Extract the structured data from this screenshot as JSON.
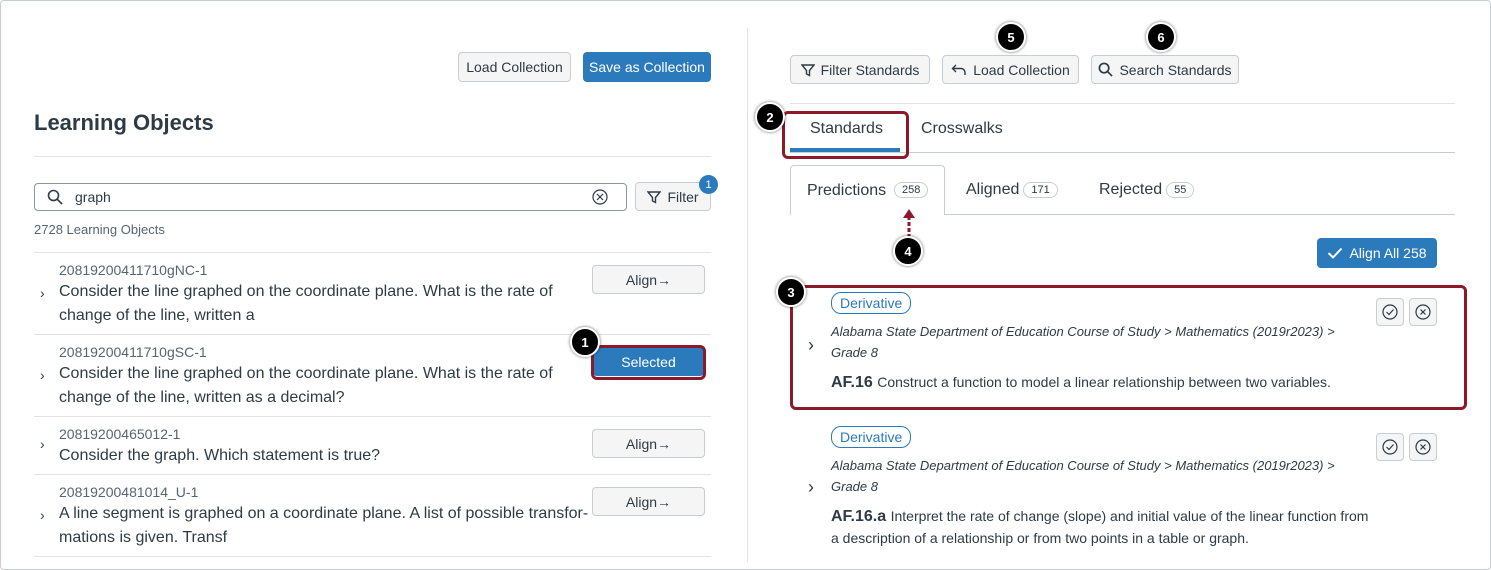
{
  "left": {
    "load_collection": "Load Collection",
    "save_collection": "Save as Collection",
    "title": "Learning Objects",
    "search_value": "graph",
    "filter_label": "Filter",
    "filter_count": "1",
    "result_count": "2728 Learning Objects",
    "rows": [
      {
        "id": "20819200411710gNC-1",
        "text1": "Consider the line graphed on the coordinate plane. What is the rate of",
        "text2": "change of the line, written a",
        "button": "Align→"
      },
      {
        "id": "20819200411710gSC-1",
        "text1": "Consider the line graphed on the coordinate plane. What is the rate of",
        "text2": "change of the line, written as a decimal?",
        "button": "Selected"
      },
      {
        "id": "20819200465012-1",
        "text1": "Consider the graph. Which statement is true?",
        "text2": "",
        "button": "Align→"
      },
      {
        "id": "20819200481014_U-1",
        "text1": "A line segment is graphed on a coordinate plane. A list of possible transfor-",
        "text2": "mations is given. Transf",
        "button": "Align→"
      }
    ]
  },
  "right": {
    "filter_standards": "Filter Standards",
    "load_collection": "Load Collection",
    "search_standards": "Search Standards",
    "tabs": [
      "Standards",
      "Crosswalks"
    ],
    "subtabs": [
      {
        "label": "Predictions",
        "count": "258"
      },
      {
        "label": "Aligned",
        "count": "171"
      },
      {
        "label": "Rejected",
        "count": "55"
      }
    ],
    "align_all": "Align All 258",
    "standards": [
      {
        "tag": "Derivative",
        "crumb1": "Alabama State Department of Education Course of Study > Mathematics (2019r2023) >",
        "crumb2": "Grade 8",
        "code": "AF.16",
        "text1": "Construct a function to model a linear relationship between two variables.",
        "text2": ""
      },
      {
        "tag": "Derivative",
        "crumb1": "Alabama State Department of Education Course of Study > Mathematics (2019r2023) >",
        "crumb2": "Grade 8",
        "code": "AF.16.a",
        "text1": "Interpret the rate of change (slope) and initial value of the linear function from",
        "text2": "a description of a relationship or from two points in a table or graph."
      }
    ]
  },
  "callouts": [
    "1",
    "2",
    "3",
    "4",
    "5",
    "6"
  ],
  "colors": {
    "primary": "#2b7abc",
    "highlight": "#8b1a2b"
  }
}
